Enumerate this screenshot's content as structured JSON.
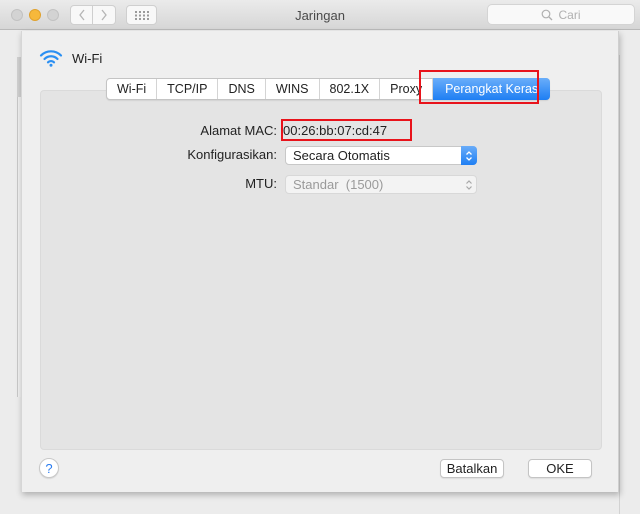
{
  "window": {
    "title": "Jaringan",
    "search_placeholder": "Cari"
  },
  "sheet": {
    "service_name": "Wi-Fi",
    "service_icon": "wifi-icon",
    "tabs": [
      {
        "label": "Wi-Fi",
        "active": false
      },
      {
        "label": "TCP/IP",
        "active": false
      },
      {
        "label": "DNS",
        "active": false
      },
      {
        "label": "WINS",
        "active": false
      },
      {
        "label": "802.1X",
        "active": false
      },
      {
        "label": "Proxy",
        "active": false
      },
      {
        "label": "Perangkat Keras",
        "active": true
      }
    ],
    "form": {
      "mac_label": "Alamat MAC:",
      "mac_value": "00:26:bb:07:cd:47",
      "configure_label": "Konfigurasikan:",
      "configure_value": "Secara Otomatis",
      "mtu_label": "MTU:",
      "mtu_value": "Standar  (1500)"
    },
    "buttons": {
      "help": "?",
      "cancel": "Batalkan",
      "ok": "OKE"
    }
  },
  "colors": {
    "accent_blue": "#1e7ef3",
    "highlight_red": "#e8131b",
    "minimize_yellow": "#f6b83b"
  }
}
